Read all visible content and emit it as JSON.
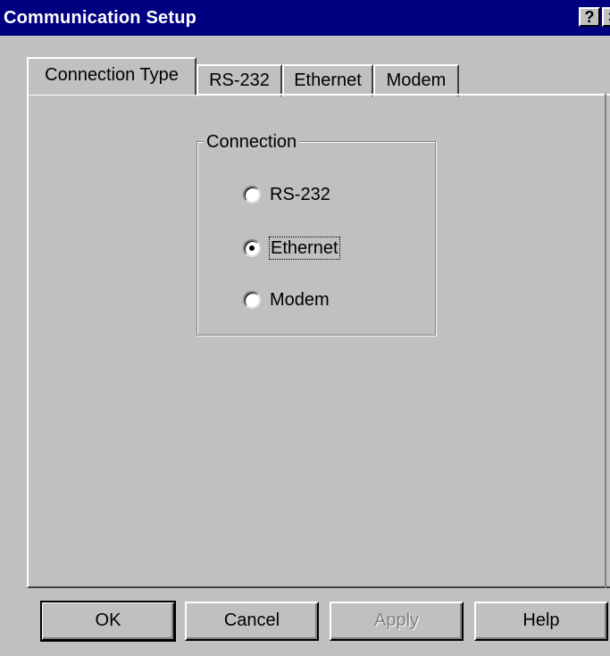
{
  "window": {
    "title": "Communication Setup",
    "help_button": "?",
    "close_button": "×"
  },
  "tabs": [
    {
      "label": "Connection Type",
      "active": true
    },
    {
      "label": "RS-232",
      "active": false
    },
    {
      "label": "Ethernet",
      "active": false
    },
    {
      "label": "Modem",
      "active": false
    }
  ],
  "connection_group": {
    "legend": "Connection",
    "options": [
      {
        "label": "RS-232",
        "selected": false
      },
      {
        "label": "Ethernet",
        "selected": true
      },
      {
        "label": "Modem",
        "selected": false
      }
    ]
  },
  "buttons": {
    "ok": "OK",
    "cancel": "Cancel",
    "apply": "Apply",
    "help": "Help"
  },
  "colors": {
    "titlebar": "#000080",
    "face": "#c0c0c0",
    "disabled_text": "#808080"
  }
}
